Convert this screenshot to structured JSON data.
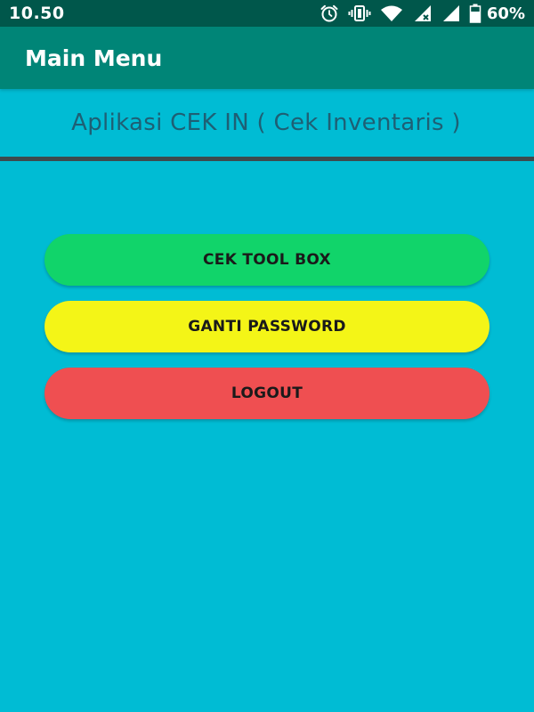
{
  "status_bar": {
    "time": "10.50",
    "battery_percent": "60%",
    "icons": [
      "alarm-icon",
      "vibrate-icon",
      "wifi-icon",
      "signal-icon",
      "signal-icon",
      "battery-icon"
    ]
  },
  "app_bar": {
    "title": "Main Menu"
  },
  "header": {
    "text": "Aplikasi CEK IN ( Cek Inventaris )"
  },
  "menu": {
    "buttons": [
      {
        "label": "CEK TOOL BOX",
        "color": "#11D46A"
      },
      {
        "label": "GANTI PASSWORD",
        "color": "#F4F517"
      },
      {
        "label": "LOGOUT",
        "color": "#EF4F51"
      }
    ]
  },
  "colors": {
    "status_bar": "#00574B",
    "app_bar": "#008577",
    "background": "#00BCD4",
    "header_text": "#1E5F74",
    "divider": "#3D4A4D"
  }
}
